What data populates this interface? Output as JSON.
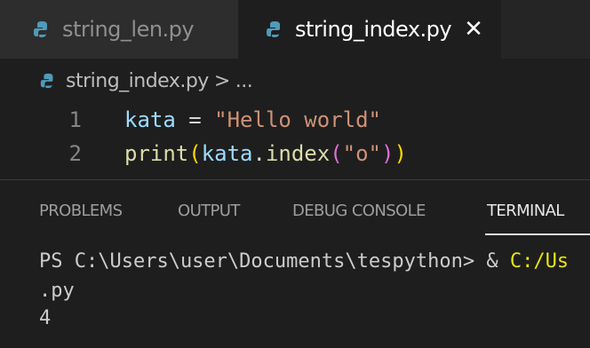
{
  "tabs": [
    {
      "label": "string_len.py",
      "active": false
    },
    {
      "label": "string_index.py",
      "active": true,
      "close_glyph": "✕"
    }
  ],
  "breadcrumb": {
    "file": "string_index.py",
    "separator": ">",
    "ellipsis": "..."
  },
  "editor": {
    "lines": [
      {
        "number": "1",
        "text": "kata = \"Hello world\""
      },
      {
        "number": "2",
        "text": "print(kata.index(\"o\"))"
      }
    ]
  },
  "panel": {
    "tabs": [
      "PROBLEMS",
      "OUTPUT",
      "DEBUG CONSOLE",
      "TERMINAL"
    ],
    "active_tab": "TERMINAL"
  },
  "terminal": {
    "prompt": "PS C:\\Users\\user\\Documents\\tespython>",
    "command_amp": " & ",
    "command_path": "C:/Us",
    "continuation": ".py",
    "output": "4"
  },
  "colors": {
    "editor_bg": "#1e1e1e",
    "tab_inactive_bg": "#2d2d2d",
    "string": "#ce9178",
    "variable": "#9cdcfe",
    "function": "#dcdcaa",
    "python_icon": "#519aba"
  },
  "icons": {
    "file_icon": "python-file-icon",
    "close_icon": "close-icon"
  }
}
